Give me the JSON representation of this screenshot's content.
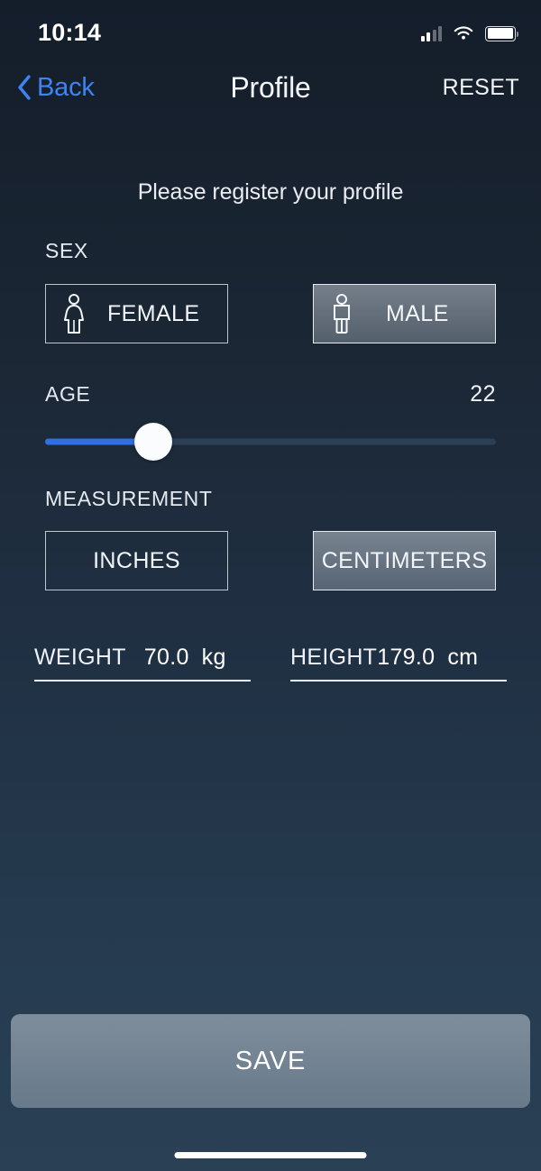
{
  "status_bar": {
    "time": "10:14",
    "icons": [
      "cellular-signal-icon",
      "wifi-icon",
      "battery-icon"
    ],
    "signal_bars_filled": 2,
    "signal_bars_total": 4,
    "battery_level": "full"
  },
  "nav": {
    "back_label": "Back",
    "back_icon": "chevron-left-icon",
    "title": "Profile",
    "reset_label": "RESET",
    "accent_color": "#3d83f2"
  },
  "subtitle": "Please register your profile",
  "sex": {
    "label": "SEX",
    "options": [
      {
        "label": "FEMALE",
        "icon": "female-person-icon",
        "selected": false
      },
      {
        "label": "MALE",
        "icon": "male-person-icon",
        "selected": true
      }
    ]
  },
  "age": {
    "label": "AGE",
    "value": "22",
    "slider_percent": 24,
    "track_color": "#2b3f55",
    "fill_color": "#2f6fe4",
    "thumb_color": "#fbfcfd"
  },
  "measurement": {
    "label": "MEASUREMENT",
    "options": [
      {
        "label": "INCHES",
        "selected": false
      },
      {
        "label": "CENTIMETERS",
        "selected": true
      }
    ]
  },
  "fields": {
    "weight": {
      "name": "WEIGHT",
      "value": "70.0",
      "unit": "kg"
    },
    "height": {
      "name": "HEIGHT",
      "value": "179.0",
      "unit": "cm"
    }
  },
  "save": {
    "label": "SAVE"
  },
  "theme": {
    "background_top": "#17212e",
    "background_bottom": "#2a4054",
    "text_color": "#ffffff"
  }
}
